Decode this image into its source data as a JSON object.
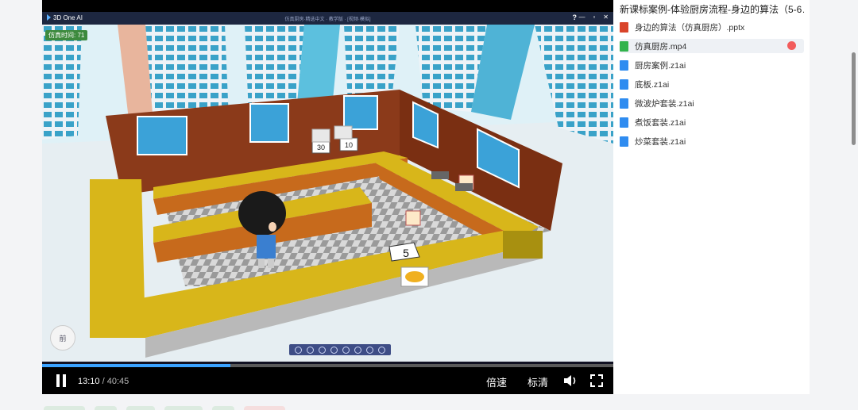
{
  "player": {
    "app_name": "3D One AI",
    "app_window_title": "仿真厨房·精选中文 · 教学版 · [视频·模拟]",
    "window_controls": [
      "—",
      "▫",
      "✕"
    ],
    "sim_time_label": "仿真时间: 71",
    "view_cube_label": "前",
    "counter_sign_text": "5",
    "wall_sign_1": "30",
    "wall_sign_2": "10",
    "progress_fraction": 0.33,
    "current_time": "13:10",
    "separator": " / ",
    "total_time": "40:45",
    "speed_label": "倍速",
    "quality_label": "标清"
  },
  "panel": {
    "title": "新课标案例-体验厨房流程-身边的算法（5-6…",
    "files": [
      {
        "name": "身边的算法（仿真厨房）.pptx",
        "type": "ppt",
        "icon": "ppt-file-icon",
        "active": false
      },
      {
        "name": "仿真厨房.mp4",
        "type": "mp4",
        "icon": "video-file-icon",
        "active": true
      },
      {
        "name": "厨房案例.z1ai",
        "type": "zai",
        "icon": "z1ai-file-icon",
        "active": false
      },
      {
        "name": "底板.z1ai",
        "type": "zai",
        "icon": "z1ai-file-icon",
        "active": false
      },
      {
        "name": "微波炉套装.z1ai",
        "type": "zai",
        "icon": "z1ai-file-icon",
        "active": false
      },
      {
        "name": "煮饭套装.z1ai",
        "type": "zai",
        "icon": "z1ai-file-icon",
        "active": false
      },
      {
        "name": "炒菜套装.z1ai",
        "type": "zai",
        "icon": "z1ai-file-icon",
        "active": false
      }
    ]
  },
  "colors": {
    "progress": "#3aa3ff",
    "wall": "#8b3a1a",
    "counter_top": "#d8b61a",
    "active_dot": "#f25c5c"
  }
}
